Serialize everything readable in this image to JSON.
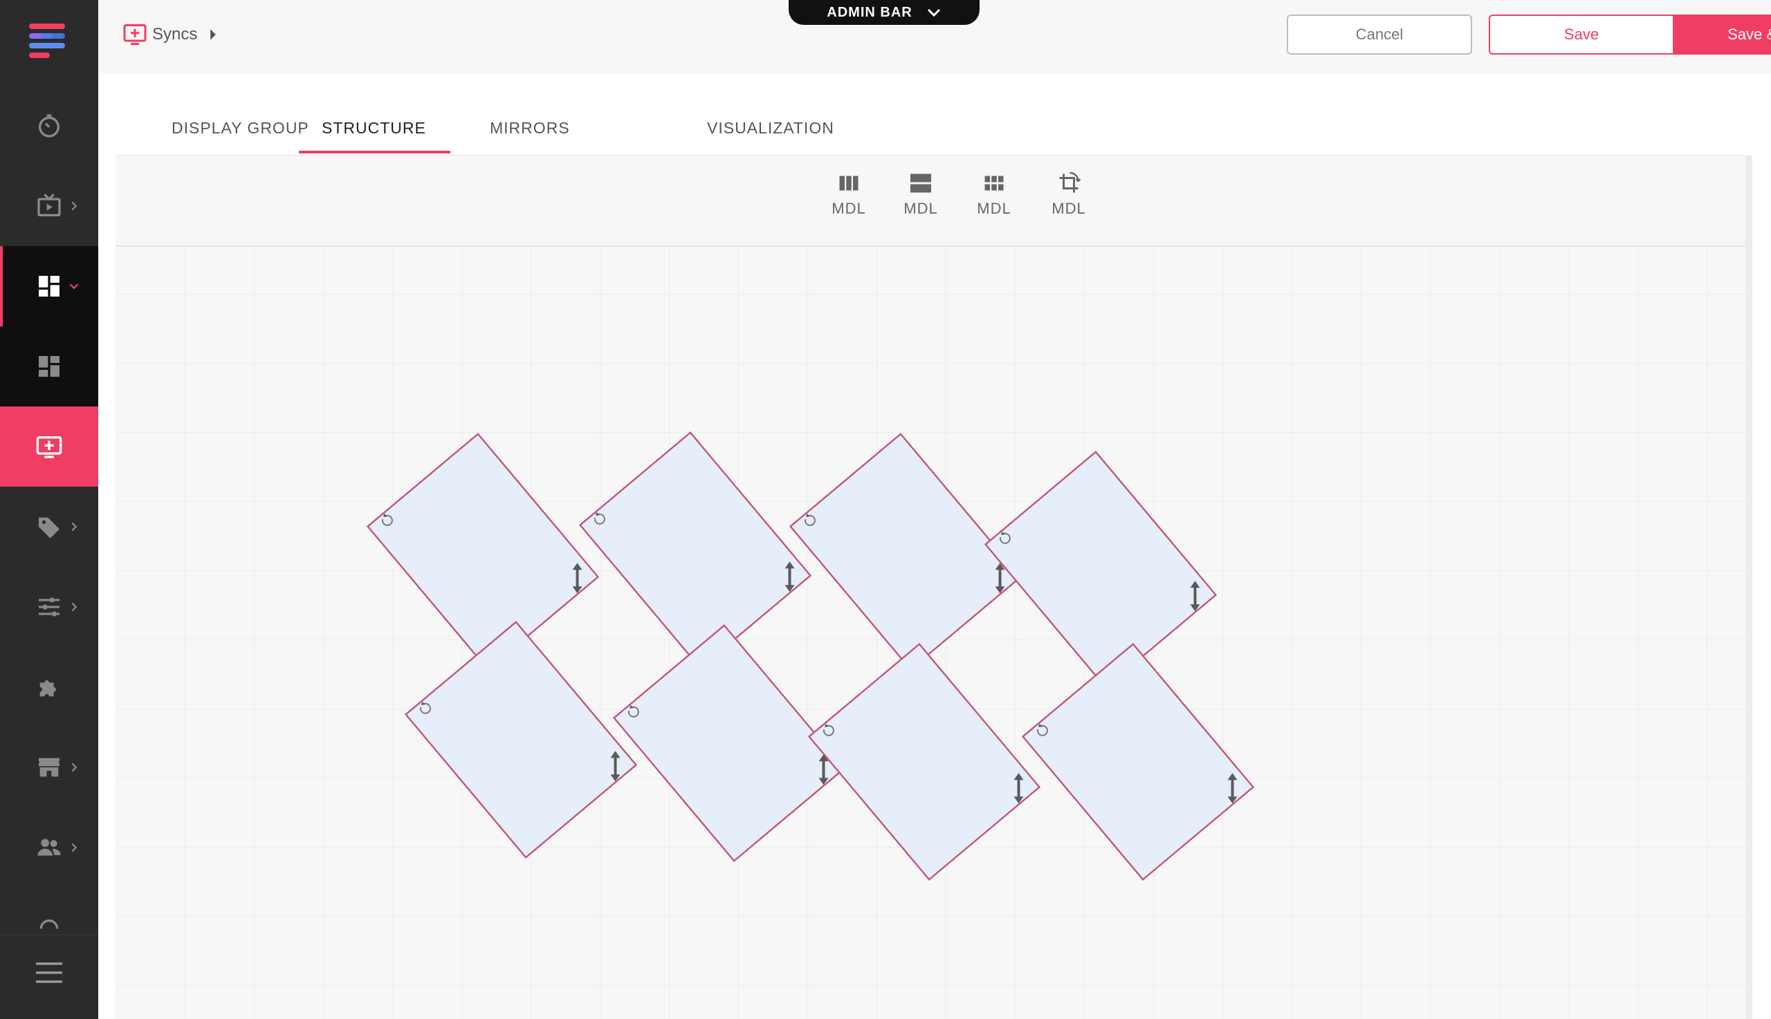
{
  "admin_bar": {
    "label": "ADMIN BAR"
  },
  "header": {
    "breadcrumb": "Syncs",
    "cancel_label": "Cancel",
    "save_label": "Save",
    "save_exit_label": "Save & Exit"
  },
  "sidebar": {
    "items": [
      {
        "icon": "timer-icon"
      },
      {
        "icon": "tv-play-icon",
        "has_children": true
      },
      {
        "icon": "dashboard-icon",
        "has_children": true,
        "expanded": true
      },
      {
        "icon": "dashboard-icon"
      },
      {
        "icon": "sync-screen-icon",
        "active": true
      },
      {
        "icon": "tag-icon",
        "has_children": true
      },
      {
        "icon": "sliders-icon",
        "has_children": true
      },
      {
        "icon": "puzzle-icon"
      },
      {
        "icon": "store-icon",
        "has_children": true
      },
      {
        "icon": "users-icon",
        "has_children": true
      }
    ],
    "menu_icon": "hamburger-icon"
  },
  "tabs": [
    {
      "label": "DISPLAY GROUP"
    },
    {
      "label": "STRUCTURE",
      "active": true
    },
    {
      "label": "MIRRORS"
    },
    {
      "label": "VISUALIZATION"
    }
  ],
  "toolbar": {
    "tools": [
      {
        "label": "MDL",
        "icon": "columns-icon"
      },
      {
        "label": "MDL",
        "icon": "rows-icon"
      },
      {
        "label": "MDL",
        "icon": "grid-icon"
      },
      {
        "label": "MDL",
        "icon": "crop-rotate-icon"
      }
    ]
  },
  "canvas": {
    "screen_count": 8,
    "screen_rotation_deg": 50
  },
  "colors": {
    "accent": "#ef3e62",
    "sidebar": "#2b2b2b",
    "screen_fill": "#e6eef9",
    "screen_border": "#c2567a"
  }
}
